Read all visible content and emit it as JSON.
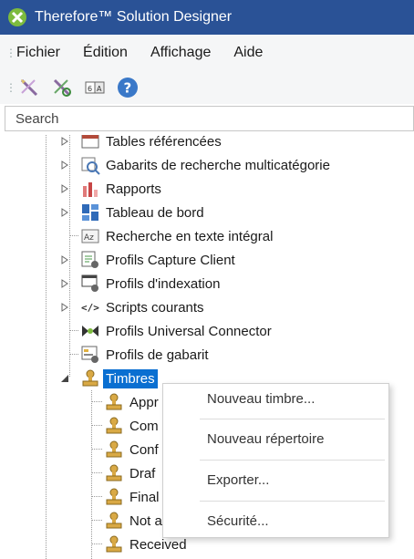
{
  "window": {
    "title": "Therefore™ Solution Designer"
  },
  "menu": {
    "items": [
      "Fichier",
      "Édition",
      "Affichage",
      "Aide"
    ]
  },
  "toolbar": {
    "buttons": [
      "wand-icon",
      "wand-refresh-icon",
      "translate-icon",
      "help-icon"
    ]
  },
  "search": {
    "placeholder": "Search"
  },
  "tree": {
    "items": [
      {
        "label": "Tables référencées",
        "icon": "table-icon"
      },
      {
        "label": "Gabarits de recherche multicatégorie",
        "icon": "search-template-icon"
      },
      {
        "label": "Rapports",
        "icon": "report-icon"
      },
      {
        "label": "Tableau de bord",
        "icon": "dashboard-icon"
      },
      {
        "label": "Recherche en texte intégral",
        "icon": "fulltext-icon"
      },
      {
        "label": "Profils Capture Client",
        "icon": "capture-profile-icon"
      },
      {
        "label": "Profils d'indexation",
        "icon": "index-profile-icon"
      },
      {
        "label": "Scripts courants",
        "icon": "script-icon"
      },
      {
        "label": "Profils Universal Connector",
        "icon": "connector-icon"
      },
      {
        "label": "Profils de gabarit",
        "icon": "template-profile-icon"
      },
      {
        "label": "Timbres",
        "icon": "stamp-icon"
      }
    ],
    "children": [
      {
        "label": "Appr",
        "icon": "stamp-icon"
      },
      {
        "label": "Com",
        "icon": "stamp-icon"
      },
      {
        "label": "Conf",
        "icon": "stamp-icon"
      },
      {
        "label": "Draf",
        "icon": "stamp-icon"
      },
      {
        "label": "Final",
        "icon": "stamp-icon"
      },
      {
        "label": "Not a",
        "icon": "stamp-icon"
      },
      {
        "label": "Received",
        "icon": "stamp-icon"
      }
    ]
  },
  "context_menu": {
    "items": [
      "Nouveau timbre...",
      "Nouveau répertoire",
      "Exporter...",
      "Sécurité..."
    ]
  },
  "colors": {
    "titlebar": "#2a5296",
    "selection": "#0a6fd1",
    "stamp": "#d9a945"
  }
}
